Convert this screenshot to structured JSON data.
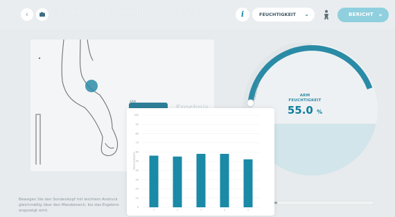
{
  "toolbar": {
    "back_glyph": "‹",
    "camera_icon": "camera-icon",
    "title": "GESICHTS- UND KÖRPER-MESSUNGEN",
    "info_label": "i",
    "metric_select": {
      "value": "FEUCHTIGKEIT",
      "chevron": "⌄"
    },
    "person_icon": "person-icon",
    "report_button": {
      "label": "BERICHT",
      "arrow": "»"
    }
  },
  "gauge": {
    "level_label": "FEUCHTIGKEIT",
    "title_line1": "ARM",
    "title_line2": "FEUCHTIGKEIT",
    "value": "55.0",
    "unit": "%",
    "fill_fraction": 0.55,
    "accent_color": "#1a8aa6"
  },
  "tabs": {
    "small_label": "ARM",
    "blurred_text": "Ergebnis"
  },
  "hint_text": "Bewegen Sie den Sondenkopf mit leichtem Andruck gleichmäßig über den Messbereich, bis das Ergebnis angezeigt wird.",
  "chart_data": {
    "type": "bar",
    "categories": [
      "1",
      "2",
      "3",
      "4",
      "5"
    ],
    "values": [
      56,
      55,
      58,
      58,
      52
    ],
    "ylabel": "FEUCHTIGKEIT",
    "ylim": [
      0,
      100
    ],
    "yticks": [
      "0",
      "10",
      "20",
      "30",
      "40",
      "50",
      "60",
      "70",
      "80",
      "90",
      "100"
    ],
    "grid": true,
    "bar_color": "#1a8aa6"
  }
}
